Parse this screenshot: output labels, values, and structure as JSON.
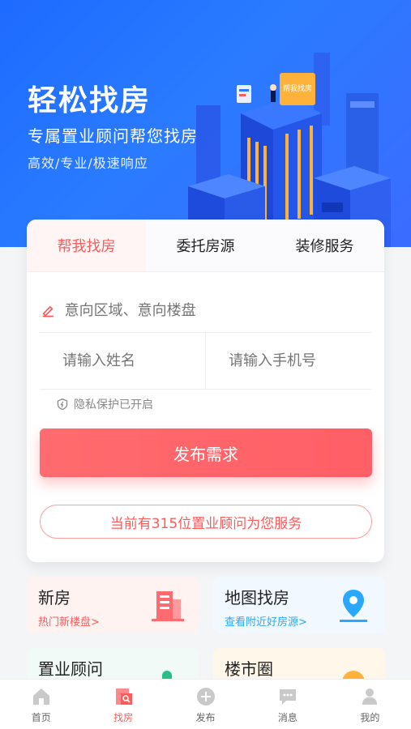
{
  "hero": {
    "title": "轻松找房",
    "subtitle": "专属置业顾问帮您找房",
    "tags": "高效/专业/极速响应",
    "sign_text": "帮我找房"
  },
  "tabs": [
    {
      "label": "帮我找房",
      "active": true
    },
    {
      "label": "委托房源",
      "active": false
    },
    {
      "label": "装修服务",
      "active": false
    }
  ],
  "form": {
    "area_placeholder": "意向区域、意向楼盘",
    "name_placeholder": "请输入姓名",
    "phone_placeholder": "请输入手机号",
    "privacy_text": "隐私保护已开启",
    "submit_label": "发布需求",
    "advisor_text": "当前有315位置业顾问为您服务"
  },
  "tiles": [
    {
      "title": "新房",
      "subtitle": "热门新楼盘>",
      "accent": "#ff5a5a",
      "icon": "building-icon"
    },
    {
      "title": "地图找房",
      "subtitle": "查看附近好房源>",
      "accent": "#2aa7ff",
      "icon": "map-pin-icon"
    },
    {
      "title": "置业顾问",
      "subtitle": "",
      "accent": "#29c087",
      "icon": "advisor-icon"
    },
    {
      "title": "楼市圈",
      "subtitle": "",
      "accent": "#ffb23a",
      "icon": "circle-icon"
    }
  ],
  "nav": [
    {
      "label": "首页",
      "icon": "home-icon",
      "active": false
    },
    {
      "label": "找房",
      "icon": "find-house-icon",
      "active": true
    },
    {
      "label": "发布",
      "icon": "plus-icon",
      "active": false
    },
    {
      "label": "消息",
      "icon": "message-icon",
      "active": false
    },
    {
      "label": "我的",
      "icon": "user-icon",
      "active": false
    }
  ],
  "colors": {
    "hero_blue": "#2a7bff",
    "primary_red": "#ff5f66"
  }
}
